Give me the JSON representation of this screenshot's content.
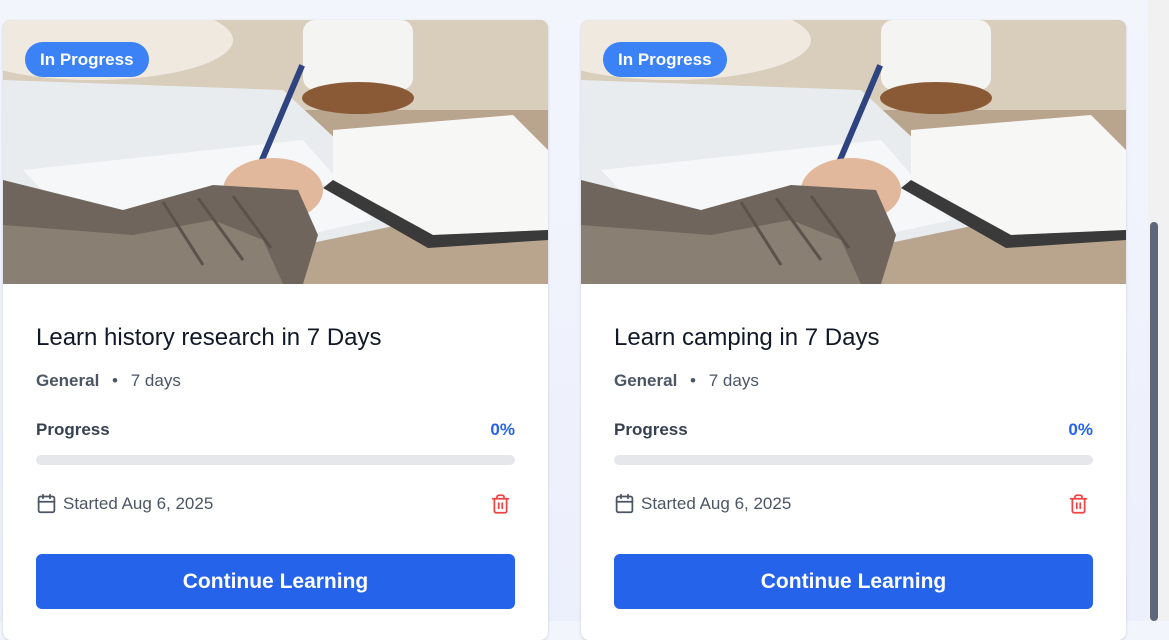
{
  "courses": [
    {
      "status": "In Progress",
      "title": "Learn history research in 7 Days",
      "category": "General",
      "duration": "7 days",
      "progress_label": "Progress",
      "progress_text": "0%",
      "progress_value": 0,
      "started": "Started Aug 6, 2025",
      "cta": "Continue Learning",
      "thumbnail_icon": "photo-writing-notebook"
    },
    {
      "status": "In Progress",
      "title": "Learn camping in 7 Days",
      "category": "General",
      "duration": "7 days",
      "progress_label": "Progress",
      "progress_text": "0%",
      "progress_value": 0,
      "started": "Started Aug 6, 2025",
      "cta": "Continue Learning",
      "thumbnail_icon": "photo-writing-notebook"
    }
  ],
  "icons": {
    "calendar": "calendar-icon",
    "delete": "trash-icon"
  },
  "colors": {
    "accent": "#2563eb",
    "badge": "#3b82f6",
    "danger": "#ef4444",
    "track": "#e5e7eb"
  }
}
